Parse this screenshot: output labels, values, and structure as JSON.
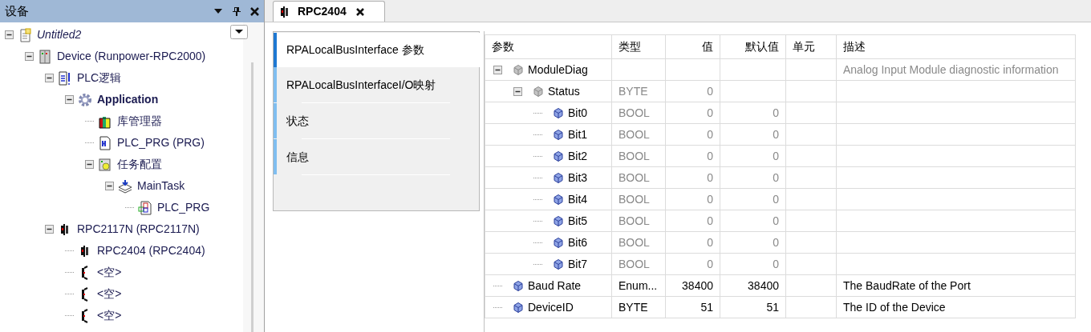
{
  "devices_panel": {
    "title": "设备",
    "tree": [
      {
        "label": "Untitled2",
        "kind": "project",
        "italic": true,
        "bold": false,
        "expanded": true,
        "children": [
          {
            "label": "Device (Runpower-RPC2000)",
            "kind": "device",
            "italic": false,
            "bold": false,
            "expanded": true,
            "children": [
              {
                "label": "PLC逻辑",
                "kind": "logic",
                "italic": false,
                "bold": false,
                "expanded": true,
                "children": [
                  {
                    "label": "Application",
                    "kind": "app",
                    "italic": false,
                    "bold": true,
                    "expanded": true,
                    "children": [
                      {
                        "label": "库管理器",
                        "kind": "library",
                        "italic": false,
                        "bold": false
                      },
                      {
                        "label": "PLC_PRG (PRG)",
                        "kind": "pou",
                        "italic": false,
                        "bold": false
                      },
                      {
                        "label": "任务配置",
                        "kind": "taskconfig",
                        "italic": false,
                        "bold": false,
                        "expanded": true,
                        "children": [
                          {
                            "label": "MainTask",
                            "kind": "task",
                            "italic": false,
                            "bold": false,
                            "expanded": true,
                            "children": [
                              {
                                "label": "PLC_PRG",
                                "kind": "call",
                                "italic": false,
                                "bold": false
                              }
                            ]
                          }
                        ]
                      }
                    ]
                  }
                ]
              },
              {
                "label": "RPC2117N (RPC2117N)",
                "kind": "module",
                "italic": false,
                "bold": false,
                "expanded": true,
                "children": [
                  {
                    "label": "RPC2404 (RPC2404)",
                    "kind": "module",
                    "italic": false,
                    "bold": false
                  },
                  {
                    "label": "<空>",
                    "kind": "slot",
                    "italic": false,
                    "bold": false
                  },
                  {
                    "label": "<空>",
                    "kind": "slot",
                    "italic": false,
                    "bold": false
                  },
                  {
                    "label": "<空>",
                    "kind": "slot",
                    "italic": false,
                    "bold": false
                  }
                ]
              }
            ]
          }
        ]
      }
    ]
  },
  "editor": {
    "tab": {
      "label": "RPC2404"
    },
    "side_tabs": [
      {
        "label": "RPALocalBusInterface 参数",
        "selected": true
      },
      {
        "label": "RPALocalBusInterfaceI/O映射",
        "selected": false
      },
      {
        "label": "状态",
        "selected": false
      },
      {
        "label": "信息",
        "selected": false
      }
    ],
    "table": {
      "columns": [
        "参数",
        "类型",
        "值",
        "默认值",
        "单元",
        "描述"
      ],
      "rows": [
        {
          "name": "ModuleDiag",
          "kind": "group",
          "readonly": true,
          "description": "Analog Input Module diagnostic information",
          "expanded": true,
          "children": [
            {
              "name": "Status",
              "kind": "group",
              "readonly": true,
              "type": "BYTE",
              "value": "0",
              "expanded": true,
              "children": [
                {
                  "name": "Bit0",
                  "kind": "param",
                  "readonly": true,
                  "type": "BOOL",
                  "value": "0",
                  "default": "0"
                },
                {
                  "name": "Bit1",
                  "kind": "param",
                  "readonly": true,
                  "type": "BOOL",
                  "value": "0",
                  "default": "0"
                },
                {
                  "name": "Bit2",
                  "kind": "param",
                  "readonly": true,
                  "type": "BOOL",
                  "value": "0",
                  "default": "0"
                },
                {
                  "name": "Bit3",
                  "kind": "param",
                  "readonly": true,
                  "type": "BOOL",
                  "value": "0",
                  "default": "0"
                },
                {
                  "name": "Bit4",
                  "kind": "param",
                  "readonly": true,
                  "type": "BOOL",
                  "value": "0",
                  "default": "0"
                },
                {
                  "name": "Bit5",
                  "kind": "param",
                  "readonly": true,
                  "type": "BOOL",
                  "value": "0",
                  "default": "0"
                },
                {
                  "name": "Bit6",
                  "kind": "param",
                  "readonly": true,
                  "type": "BOOL",
                  "value": "0",
                  "default": "0"
                },
                {
                  "name": "Bit7",
                  "kind": "param",
                  "readonly": true,
                  "type": "BOOL",
                  "value": "0",
                  "default": "0"
                }
              ]
            }
          ]
        },
        {
          "name": "Baud Rate",
          "kind": "param",
          "readonly": false,
          "type": "Enum...",
          "value": "38400",
          "default": "38400",
          "description": "The BaudRate of the Port"
        },
        {
          "name": "DeviceID",
          "kind": "param",
          "readonly": false,
          "type": "BYTE",
          "value": "51",
          "default": "51",
          "description": "The ID of the Device"
        }
      ]
    }
  }
}
